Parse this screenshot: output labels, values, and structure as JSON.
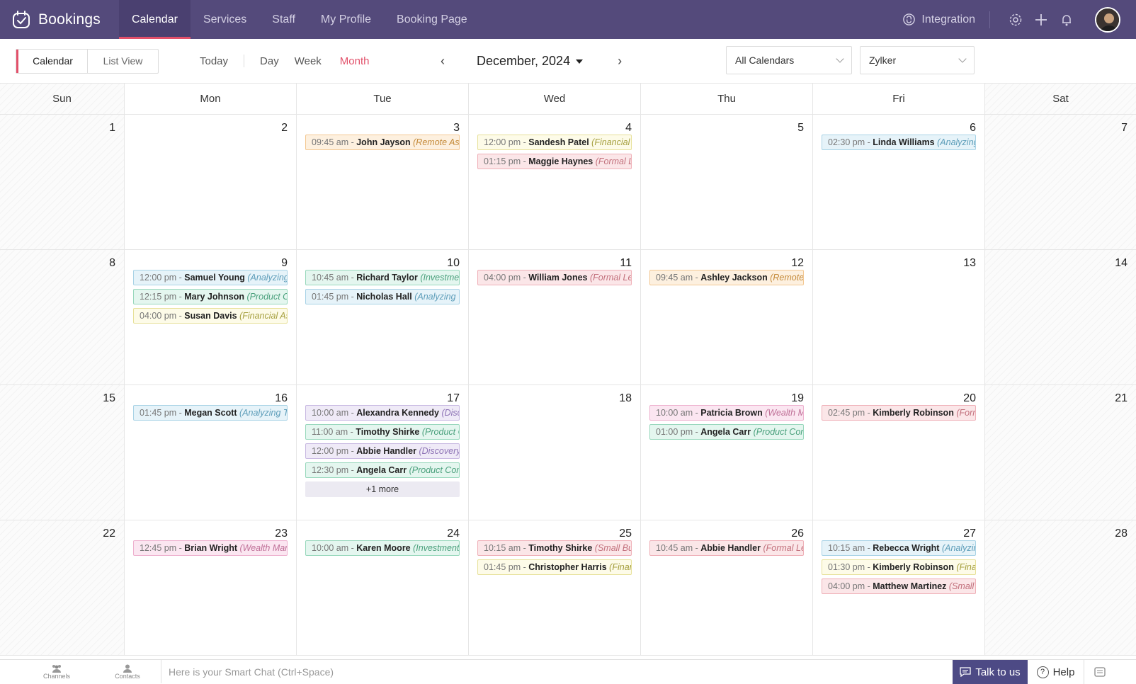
{
  "app": {
    "name": "Bookings"
  },
  "nav": {
    "tabs": [
      {
        "label": "Calendar",
        "active": true
      },
      {
        "label": "Services"
      },
      {
        "label": "Staff"
      },
      {
        "label": "My Profile"
      },
      {
        "label": "Booking Page"
      }
    ],
    "integration_label": "Integration",
    "icons": [
      "gear-icon",
      "plus-icon",
      "bell-icon"
    ]
  },
  "toolbar": {
    "view_toggle": {
      "calendar": "Calendar",
      "list": "List View"
    },
    "today": "Today",
    "day": "Day",
    "week": "Week",
    "month": "Month",
    "current_month": "December, 2024",
    "calendar_filter": "All Calendars",
    "workspace_filter": "Zylker"
  },
  "colors": {
    "brand": "#544a7b",
    "accent": "#e2506a"
  },
  "calendar": {
    "weekdays": [
      "Sun",
      "Mon",
      "Tue",
      "Wed",
      "Thu",
      "Fri",
      "Sat"
    ],
    "weeks": [
      [
        {
          "day": "1",
          "events": []
        },
        {
          "day": "2",
          "events": []
        },
        {
          "day": "3",
          "events": [
            {
              "time": "09:45 am - ",
              "name": "John Jayson",
              "service": "(Remote Ass",
              "color": "orange"
            }
          ]
        },
        {
          "day": "4",
          "events": [
            {
              "time": "12:00 pm - ",
              "name": "Sandesh Patel",
              "service": "(Financial A",
              "color": "yellow"
            },
            {
              "time": "01:15 pm - ",
              "name": "Maggie Haynes",
              "service": "(Formal Le",
              "color": "red"
            }
          ]
        },
        {
          "day": "5",
          "events": []
        },
        {
          "day": "6",
          "events": [
            {
              "time": "02:30 pm - ",
              "name": "Linda Williams",
              "service": "(Analyzing",
              "color": "blue"
            }
          ]
        },
        {
          "day": "7",
          "events": []
        }
      ],
      [
        {
          "day": "8",
          "events": []
        },
        {
          "day": "9",
          "events": [
            {
              "time": "12:00 pm - ",
              "name": "Samuel Young",
              "service": "(Analyzing",
              "color": "blue"
            },
            {
              "time": "12:15 pm - ",
              "name": "Mary Johnson",
              "service": "(Product Co",
              "color": "green"
            },
            {
              "time": "04:00 pm - ",
              "name": "Susan Davis",
              "service": "(Financial As",
              "color": "yellow"
            }
          ]
        },
        {
          "day": "10",
          "events": [
            {
              "time": "10:45 am - ",
              "name": "Richard Taylor",
              "service": "(Investmen",
              "color": "green"
            },
            {
              "time": "01:45 pm - ",
              "name": "Nicholas Hall",
              "service": "(Analyzing T",
              "color": "blue"
            }
          ]
        },
        {
          "day": "11",
          "events": [
            {
              "time": "04:00 pm - ",
              "name": "William Jones",
              "service": "(Formal Le",
              "color": "red"
            }
          ]
        },
        {
          "day": "12",
          "events": [
            {
              "time": "09:45 am - ",
              "name": "Ashley Jackson",
              "service": "(Remote A",
              "color": "orange"
            }
          ]
        },
        {
          "day": "13",
          "events": []
        },
        {
          "day": "14",
          "events": []
        }
      ],
      [
        {
          "day": "15",
          "events": []
        },
        {
          "day": "16",
          "events": [
            {
              "time": "01:45 pm - ",
              "name": "Megan Scott",
              "service": "(Analyzing T",
              "color": "blue"
            }
          ]
        },
        {
          "day": "17",
          "events": [
            {
              "time": "10:00 am - ",
              "name": "Alexandra Kennedy",
              "service": "(Disc",
              "color": "purple"
            },
            {
              "time": "11:00 am - ",
              "name": "Timothy Shirke",
              "service": "(Product C",
              "color": "green"
            },
            {
              "time": "12:00 pm - ",
              "name": "Abbie Handler",
              "service": "(Discovery",
              "color": "purple"
            },
            {
              "time": "12:30 pm - ",
              "name": "Angela Carr",
              "service": "(Product Con",
              "color": "green"
            }
          ],
          "more": "+1 more"
        },
        {
          "day": "18",
          "events": []
        },
        {
          "day": "19",
          "events": [
            {
              "time": "10:00 am - ",
              "name": "Patricia Brown",
              "service": "(Wealth M",
              "color": "pink"
            },
            {
              "time": "01:00 pm - ",
              "name": "Angela Carr",
              "service": "(Product Cor",
              "color": "green"
            }
          ]
        },
        {
          "day": "20",
          "events": [
            {
              "time": "02:45 pm - ",
              "name": "Kimberly Robinson",
              "service": "(Form",
              "color": "red"
            }
          ]
        },
        {
          "day": "21",
          "events": []
        }
      ],
      [
        {
          "day": "22",
          "events": []
        },
        {
          "day": "23",
          "events": [
            {
              "time": "12:45 pm - ",
              "name": "Brian Wright",
              "service": "(Wealth Man",
              "color": "pink"
            }
          ]
        },
        {
          "day": "24",
          "events": [
            {
              "time": "10:00 am - ",
              "name": "Karen Moore",
              "service": "(Investment",
              "color": "green"
            }
          ]
        },
        {
          "day": "25",
          "events": [
            {
              "time": "10:15 am - ",
              "name": "Timothy Shirke",
              "service": "(Small Bus",
              "color": "red"
            },
            {
              "time": "01:45 pm - ",
              "name": "Christopher Harris",
              "service": "(Finan",
              "color": "yellow"
            }
          ]
        },
        {
          "day": "26",
          "events": [
            {
              "time": "10:45 am - ",
              "name": "Abbie Handler",
              "service": "(Formal Le",
              "color": "red"
            }
          ]
        },
        {
          "day": "27",
          "events": [
            {
              "time": "10:15 am - ",
              "name": "Rebecca Wright",
              "service": "(Analyzing",
              "color": "blue"
            },
            {
              "time": "01:30 pm - ",
              "name": "Kimberly Robinson",
              "service": "(Finan",
              "color": "yellow"
            },
            {
              "time": "04:00 pm - ",
              "name": "Matthew Martinez",
              "service": "(Small",
              "color": "red"
            }
          ]
        },
        {
          "day": "28",
          "events": []
        }
      ]
    ]
  },
  "bottombar": {
    "channels": "Channels",
    "contacts": "Contacts",
    "chat_placeholder": "Here is your Smart Chat (Ctrl+Space)",
    "talk": "Talk to us",
    "help": "Help"
  }
}
